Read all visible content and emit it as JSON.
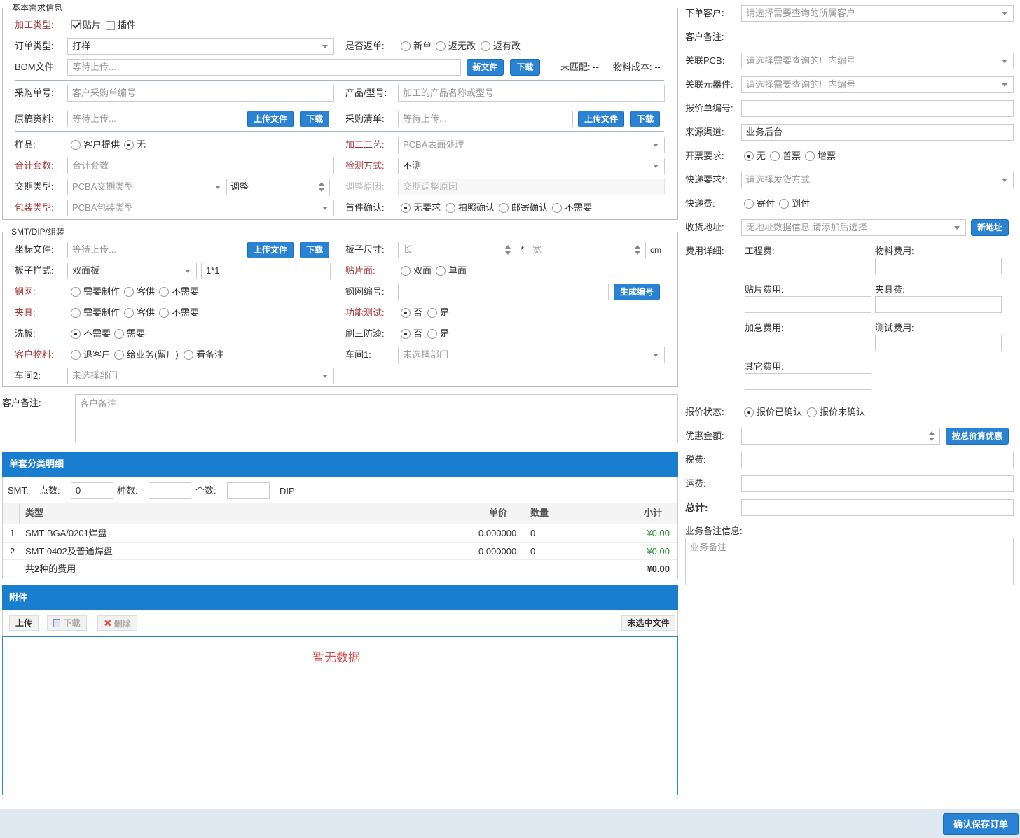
{
  "basic": {
    "legend": "基本需求信息",
    "process_type": {
      "label": "加工类型:",
      "options": [
        "贴片",
        "插件"
      ]
    },
    "order_type": {
      "label": "订单类型:",
      "value": "打样"
    },
    "return": {
      "label": "是否返单:",
      "options": [
        "新单",
        "返无改",
        "返有改"
      ]
    },
    "bom": {
      "label": "BOM文件:",
      "placeholder": "等待上传...",
      "new_btn": "新文件",
      "dl_btn": "下载",
      "unmatched": "未匹配: --",
      "cost": "物料成本: --"
    },
    "po": {
      "label": "采购单号:",
      "placeholder": "客户采购单编号"
    },
    "product": {
      "label": "产品/型号:",
      "placeholder": "加工的产品名称或型号"
    },
    "draft": {
      "label": "原稿资料:",
      "placeholder": "等待上传...",
      "upload_btn": "上传文件",
      "dl_btn": "下载"
    },
    "purchase_list": {
      "label": "采购清单:",
      "placeholder": "等待上传...",
      "upload_btn": "上传文件",
      "dl_btn": "下载"
    },
    "sample": {
      "label": "样品:",
      "options": [
        "客户提供",
        "无"
      ]
    },
    "craft": {
      "label": "加工工艺:",
      "value": "PCBA表面处理"
    },
    "sets": {
      "label": "合计套数:",
      "placeholder": "合计套数"
    },
    "inspect": {
      "label": "检测方式:",
      "value": "不测"
    },
    "delivery": {
      "label": "交期类型:",
      "value": "PCBA交期类型",
      "adjust": "调整"
    },
    "adjust_reason": {
      "label": "调整原因:",
      "placeholder": "交期调整原因"
    },
    "packing": {
      "label": "包装类型:",
      "value": "PCBA包装类型"
    },
    "first": {
      "label": "首件确认:",
      "options": [
        "无要求",
        "拍照确认",
        "邮寄确认",
        "不需要"
      ]
    }
  },
  "smt": {
    "legend": "SMT/DIP/组装",
    "coord": {
      "label": "坐标文件:",
      "placeholder": "等待上传...",
      "upload_btn": "上传文件",
      "dl_btn": "下载"
    },
    "board_size": {
      "label": "板子尺寸:",
      "len": "长",
      "wid": "宽",
      "star": "*",
      "unit": "cm"
    },
    "board_style": {
      "label": "板子样式:",
      "value": "双面板",
      "layout": "1*1"
    },
    "smt_side": {
      "label": "贴片面:",
      "options": [
        "双面",
        "单面"
      ]
    },
    "stencil": {
      "label": "钢网:",
      "options": [
        "需要制作",
        "客供",
        "不需要"
      ]
    },
    "stencil_no": {
      "label": "钢网编号:",
      "btn": "生成编号"
    },
    "fixture": {
      "label": "夹具:",
      "options": [
        "需要制作",
        "客供",
        "不需要"
      ]
    },
    "func_test": {
      "label": "功能测试:",
      "options": [
        "否",
        "是"
      ]
    },
    "wash": {
      "label": "洗板:",
      "options": [
        "不需要",
        "需要"
      ]
    },
    "coat": {
      "label": "刷三防漆:",
      "options": [
        "否",
        "是"
      ]
    },
    "cust_mat": {
      "label": "客户物料:",
      "options": [
        "退客户",
        "给业务(留厂)",
        "看备注"
      ]
    },
    "ws1": {
      "label": "车间1:",
      "value": "未选择部门"
    },
    "ws2": {
      "label": "车间2:",
      "value": "未选择部门"
    }
  },
  "remark": {
    "label": "客户备注:",
    "placeholder": "客户备注"
  },
  "detail": {
    "title": "单套分类明细",
    "smt": "SMT:",
    "points": {
      "label": "点数:",
      "value": "0"
    },
    "kinds": {
      "label": "种数:"
    },
    "count": {
      "label": "个数:"
    },
    "dip": "DIP:",
    "headers": [
      "类型",
      "单价",
      "数量",
      "小计"
    ],
    "rows": [
      {
        "no": "1",
        "type": "SMT BGA/0201焊盘",
        "price": "0.000000",
        "qty": "0",
        "sub": "¥0.00"
      },
      {
        "no": "2",
        "type": "SMT 0402及普通焊盘",
        "price": "0.000000",
        "qty": "0",
        "sub": "¥0.00"
      }
    ],
    "summary_pre": "共",
    "summary_num": "2",
    "summary_post": "种的费用",
    "total": "¥0.00"
  },
  "attach": {
    "title": "附件",
    "upload": "上传",
    "download": "下载",
    "delete": "删除",
    "unselected": "未选中文件",
    "empty": "暂无数据"
  },
  "right": {
    "customer": {
      "label": "下单客户:",
      "placeholder": "请选择需要查询的所属客户"
    },
    "cust_note": {
      "label": "客户备注:"
    },
    "pcb": {
      "label": "关联PCB:",
      "placeholder": "请选择需要查询的厂内编号"
    },
    "comp": {
      "label": "关联元器件:",
      "placeholder": "请选择需要查询的厂内编号"
    },
    "quote_no": {
      "label": "报价单编号:"
    },
    "source": {
      "label": "来源渠道:",
      "value": "业务后台"
    },
    "invoice": {
      "label": "开票要求:",
      "options": [
        "无",
        "普票",
        "增票"
      ]
    },
    "express": {
      "label": "快递要求*:",
      "placeholder": "请选择发货方式"
    },
    "express_fee": {
      "label": "快递费:",
      "options": [
        "寄付",
        "到付"
      ]
    },
    "address": {
      "label": "收货地址:",
      "placeholder": "无地址数据信息,请添加后选择",
      "btn": "新地址"
    },
    "fees": {
      "label": "费用详细:",
      "items": [
        "工程费:",
        "物料费用:",
        "贴片费用:",
        "夹具费:",
        "加急费用:",
        "测试费用:",
        "其它费用:"
      ]
    },
    "quote_state": {
      "label": "报价状态:",
      "options": [
        "报价已确认",
        "报价未确认"
      ]
    },
    "discount": {
      "label": "优惠金额:",
      "btn": "按总价算优惠"
    },
    "tax": {
      "label": "税费:"
    },
    "freight": {
      "label": "运费:"
    },
    "total": {
      "label": "总计:"
    },
    "biz_note": {
      "label": "业务备注信息:",
      "placeholder": "业务备注"
    }
  },
  "footer": {
    "save": "确认保存订单"
  }
}
